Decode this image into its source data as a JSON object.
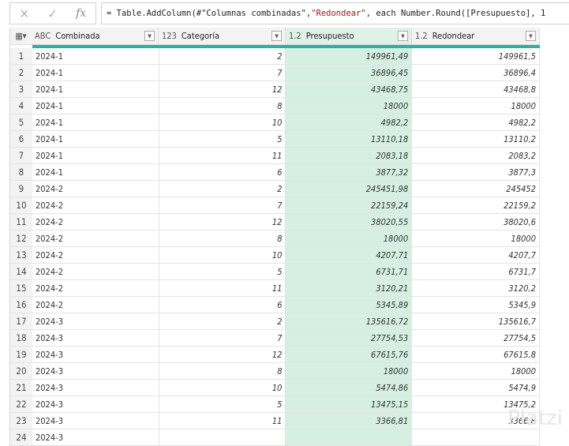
{
  "formula_bar": {
    "cancel_icon": "✕",
    "confirm_icon": "✓",
    "fx_label": "fx",
    "formula_prefix": "= Table.AddColumn(#\"Columnas combinadas\", ",
    "formula_string": "\"Redondear\"",
    "formula_suffix": ", each Number.Round([Presupuesto], 1"
  },
  "table": {
    "columns": [
      {
        "type": "ABC",
        "name": "Combinada"
      },
      {
        "type": "123",
        "name": "Categoría"
      },
      {
        "type": "1.2",
        "name": "Presupuesto"
      },
      {
        "type": "1.2",
        "name": "Redondear"
      }
    ],
    "rows": [
      [
        "1",
        "2024-1",
        "2",
        "149961,49",
        "149961,5"
      ],
      [
        "2",
        "2024-1",
        "7",
        "36896,45",
        "36896,4"
      ],
      [
        "3",
        "2024-1",
        "12",
        "43468,75",
        "43468,8"
      ],
      [
        "4",
        "2024-1",
        "8",
        "18000",
        "18000"
      ],
      [
        "5",
        "2024-1",
        "10",
        "4982,2",
        "4982,2"
      ],
      [
        "6",
        "2024-1",
        "5",
        "13110,18",
        "13110,2"
      ],
      [
        "7",
        "2024-1",
        "11",
        "2083,18",
        "2083,2"
      ],
      [
        "8",
        "2024-1",
        "6",
        "3877,32",
        "3877,3"
      ],
      [
        "9",
        "2024-2",
        "2",
        "245451,98",
        "245452"
      ],
      [
        "10",
        "2024-2",
        "7",
        "22159,24",
        "22159,2"
      ],
      [
        "11",
        "2024-2",
        "12",
        "38020,55",
        "38020,6"
      ],
      [
        "12",
        "2024-2",
        "8",
        "18000",
        "18000"
      ],
      [
        "13",
        "2024-2",
        "10",
        "4207,71",
        "4207,7"
      ],
      [
        "14",
        "2024-2",
        "5",
        "6731,71",
        "6731,7"
      ],
      [
        "15",
        "2024-2",
        "11",
        "3120,21",
        "3120,2"
      ],
      [
        "16",
        "2024-2",
        "6",
        "5345,89",
        "5345,9"
      ],
      [
        "17",
        "2024-3",
        "2",
        "135616,72",
        "135616,7"
      ],
      [
        "18",
        "2024-3",
        "7",
        "27754,53",
        "27754,5"
      ],
      [
        "19",
        "2024-3",
        "12",
        "67615,76",
        "67615,8"
      ],
      [
        "20",
        "2024-3",
        "8",
        "18000",
        "18000"
      ],
      [
        "21",
        "2024-3",
        "10",
        "5474,86",
        "5474,9"
      ],
      [
        "22",
        "2024-3",
        "5",
        "13475,15",
        "13475,2"
      ],
      [
        "23",
        "2024-3",
        "11",
        "3366,81",
        "3366,8"
      ],
      [
        "24",
        "2024-3",
        "",
        "",
        ""
      ]
    ]
  },
  "watermark": "Platzi"
}
